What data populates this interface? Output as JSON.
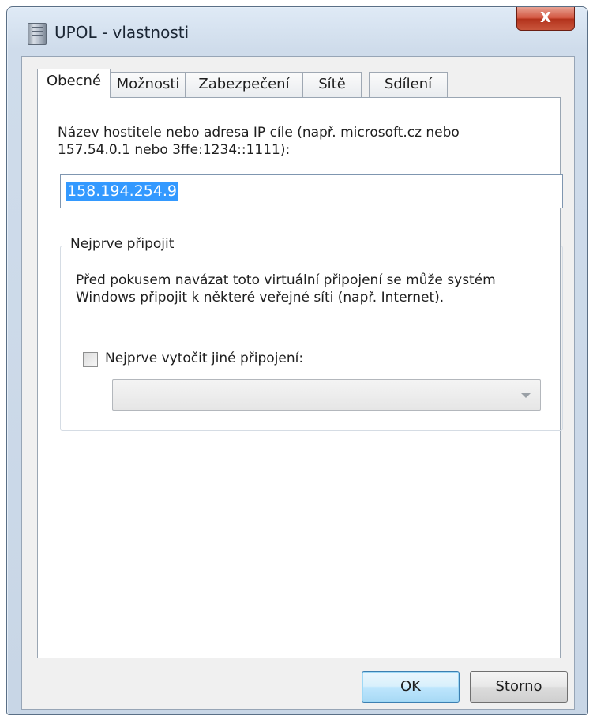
{
  "window": {
    "title": "UPOL - vlastnosti",
    "close_glyph": "X",
    "icon": "app-icon"
  },
  "tabs": [
    {
      "label": "Obecné",
      "active": true
    },
    {
      "label": "Možnosti",
      "active": false
    },
    {
      "label": "Zabezpečení",
      "active": false
    },
    {
      "label": "Sítě",
      "active": false
    },
    {
      "label": "Sdílení",
      "active": false
    }
  ],
  "general": {
    "host_label": "Název hostitele nebo adresa IP cíle (např. microsoft.cz nebo 157.54.0.1 nebo 3ffe:1234::1111):",
    "host_value": "158.194.254.9",
    "group_title": "Nejprve připojit",
    "group_text": "Před pokusem navázat toto virtuální připojení se může systém Windows připojit k některé veřejné síti (např. Internet).",
    "checkbox_label": "Nejprve vytočit jiné připojení:",
    "checkbox_checked": false,
    "combo_value": ""
  },
  "buttons": {
    "ok": "OK",
    "cancel": "Storno"
  },
  "colors": {
    "selection": "#3399ff",
    "default_button": "#bee6fd"
  }
}
